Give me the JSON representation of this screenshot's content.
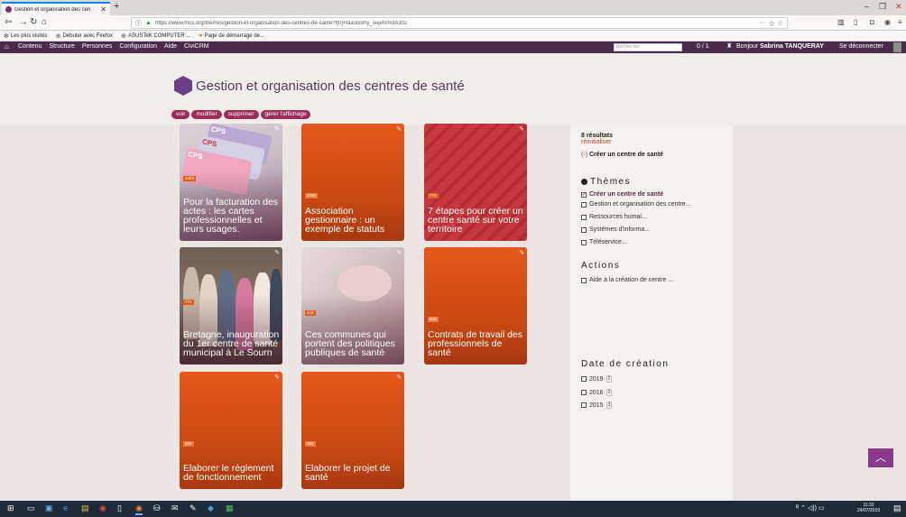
{
  "browser": {
    "tab_title": "Gestion et organisation des cen",
    "url": "https://www.fncs.org/themes/gestion-et-organisation-des-centres-de-sante?f[0]=taxonomy_sujets%3A302",
    "new_tab_label": "+",
    "bookmarks": [
      "Les plus visités",
      "Débuter avec Firefox",
      "ASUSTeK COMPUTER ...",
      "Page de démarrage de..."
    ]
  },
  "admin": {
    "menu": [
      "Contenu",
      "Structure",
      "Personnes",
      "Configuration",
      "Aide",
      "CiviCRM"
    ],
    "search_placeholder": "Rechercher",
    "count": "0 / 1",
    "hello_prefix": "Bonjour",
    "user_name": "Sabrina TANQUERAY",
    "logout": "Se déconnecter"
  },
  "page": {
    "title": "Gestion et organisation des centres de santé",
    "actions": [
      "voir",
      "modifier",
      "supprimer",
      "gérer l'affichage"
    ]
  },
  "tiles": [
    {
      "number": "3483",
      "title": "Pour la facturation des actes : les cartes professionnelles et leurs usages.",
      "style": "cards"
    },
    {
      "number": "3240",
      "title": "Association gestionnaire : un exemple de statuts",
      "style": "orange"
    },
    {
      "number": "772",
      "title": "7 étapes pour créer un centre santé sur votre territoire",
      "style": "red"
    },
    {
      "number": "771",
      "title": "Bretagne, inauguration du 1er centre de santé municipal à Le Sourn",
      "style": "people"
    },
    {
      "number": "418",
      "title": "Ces communes qui portent des politiques publiques de santé",
      "style": "hands"
    },
    {
      "number": "843",
      "title": "Contrats de travail des professionnels de santé",
      "style": "orange"
    },
    {
      "number": "842",
      "title": "Elaborer le règlement de fonctionnement",
      "style": "orange"
    },
    {
      "number": "264",
      "title": "Elaborer le projet de santé",
      "style": "orange"
    }
  ],
  "sidebar": {
    "results": "8 résultats",
    "reset": "réinitialiser",
    "active_minus": "(-)",
    "active_filter": "Créer un centre de santé",
    "themes_heading": "Thèmes",
    "themes": [
      {
        "label": "Créer un centre de santé",
        "checked": true
      },
      {
        "label": "Gestion et organisation des centre...",
        "checked": false
      },
      {
        "label": "Ressources humai...",
        "checked": false
      },
      {
        "label": "Systèmes d'informa...",
        "checked": false
      },
      {
        "label": "Téléservice...",
        "checked": false
      }
    ],
    "actions_heading": "Actions",
    "actions": [
      {
        "label": "Aide à la création de centre ...",
        "checked": false
      }
    ],
    "date_heading": "Date de création",
    "dates": [
      {
        "label": "2019",
        "count": "2"
      },
      {
        "label": "2016",
        "count": "3"
      },
      {
        "label": "2015",
        "count": "3"
      }
    ]
  },
  "taskbar": {
    "clock_time": "11:32",
    "clock_date": "24/07/2019"
  },
  "colors": {
    "admin_bar": "#4a2b4a",
    "action_button": "#9c2d58",
    "tile_orange": "#e0561a",
    "tile_red": "#c7333a",
    "logo": "#6b3e8a",
    "back_to_top": "#8a3a8a"
  }
}
